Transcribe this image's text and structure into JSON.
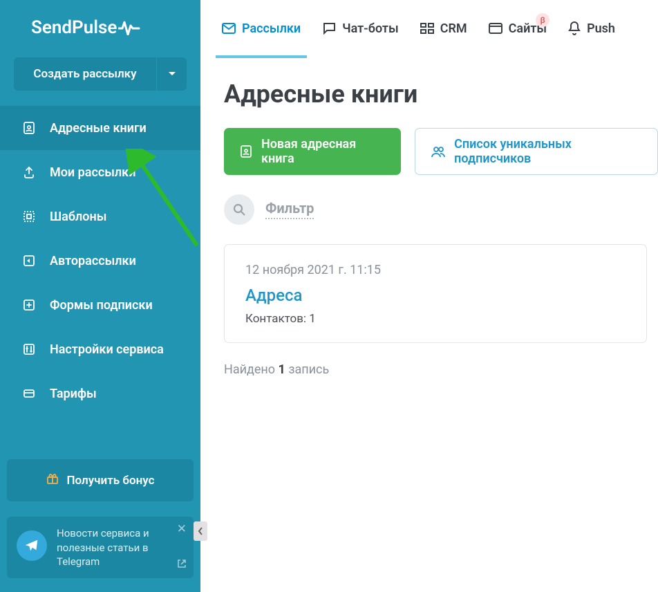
{
  "brand": "SendPulse",
  "sidebar": {
    "create_label": "Создать рассылку",
    "items": [
      {
        "label": "Адресные книги"
      },
      {
        "label": "Мои рассылки"
      },
      {
        "label": "Шаблоны"
      },
      {
        "label": "Авторассылки"
      },
      {
        "label": "Формы подписки"
      },
      {
        "label": "Настройки сервиса"
      },
      {
        "label": "Тарифы"
      }
    ],
    "bonus_label": "Получить бонус",
    "news_text": "Новости сервиса и полезные статьи в Telegram"
  },
  "topnav": {
    "items": [
      {
        "label": "Рассылки"
      },
      {
        "label": "Чат-боты"
      },
      {
        "label": "CRM"
      },
      {
        "label": "Сайты",
        "badge": "β"
      },
      {
        "label": "Push"
      }
    ]
  },
  "page": {
    "title": "Адресные книги",
    "new_book_label": "Новая адресная книга",
    "unique_list_label": "Список уникальных подписчиков",
    "filter_label": "Фильтр",
    "card": {
      "date": "12 ноября 2021 г. 11:15",
      "title": "Адреса",
      "contacts_label": "Контактов: 1"
    },
    "found_prefix": "Найдено ",
    "found_count": "1",
    "found_suffix": " запись"
  }
}
